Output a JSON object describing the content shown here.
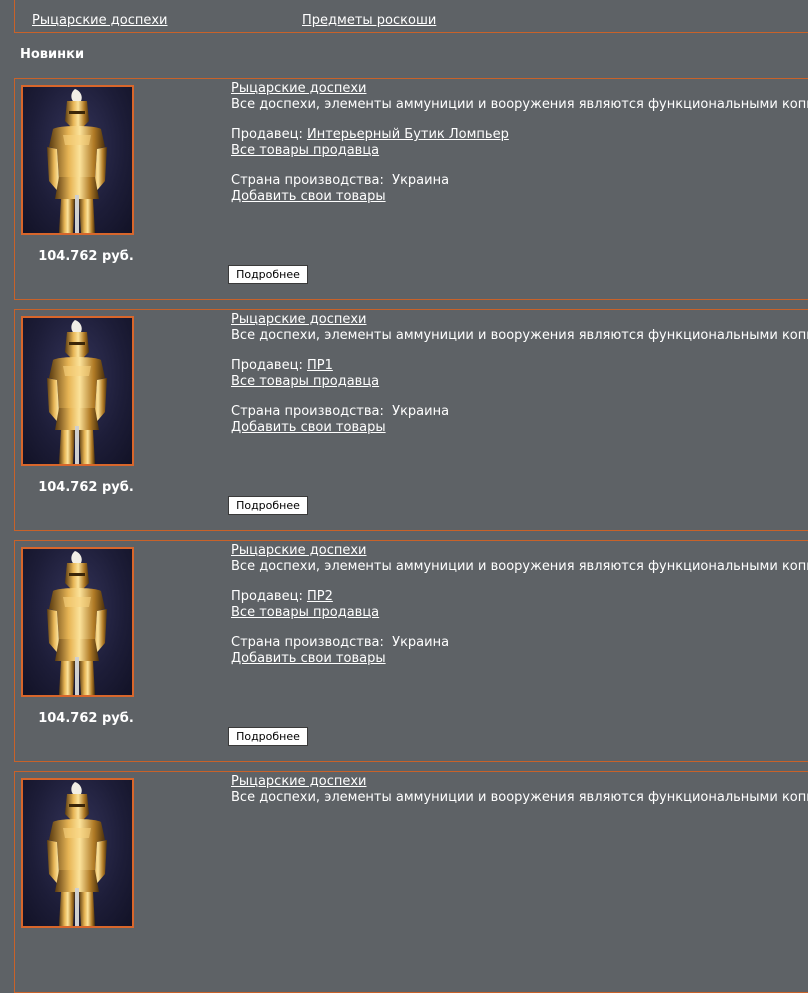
{
  "categories": [
    {
      "label": "Рыцарские доспехи"
    },
    {
      "label": "Предметы роскоши"
    }
  ],
  "section_title": "Новинки",
  "products": [
    {
      "title": "Рыцарские доспехи",
      "description": "Все доспехи, элементы аммуниции и вооружения являются функциональными копиями",
      "seller_label": "Продавец:",
      "seller_name": "Интерьерный Бутик Ломпьер",
      "all_goods_link": "Все товары продавца",
      "country_label": "Страна производства:",
      "country": "Украина",
      "add_goods_link": "Добавить свои товары",
      "price": "104.762 руб.",
      "more_button": "Подробнее"
    },
    {
      "title": "Рыцарские доспехи",
      "description": "Все доспехи, элементы аммуниции и вооружения являются функциональными копиями",
      "seller_label": "Продавец:",
      "seller_name": "ПР1",
      "all_goods_link": "Все товары продавца",
      "country_label": "Страна производства:",
      "country": "Украина",
      "add_goods_link": "Добавить свои товары",
      "price": "104.762 руб.",
      "more_button": "Подробнее"
    },
    {
      "title": "Рыцарские доспехи",
      "description": "Все доспехи, элементы аммуниции и вооружения являются функциональными копиями",
      "seller_label": "Продавец:",
      "seller_name": "ПР2",
      "all_goods_link": "Все товары продавца",
      "country_label": "Страна производства:",
      "country": "Украина",
      "add_goods_link": "Добавить свои товары",
      "price": "104.762 руб.",
      "more_button": "Подробнее"
    },
    {
      "title": "Рыцарские доспехи",
      "description": "Все доспехи, элементы аммуниции и вооружения являются функциональными копиями"
    }
  ]
}
